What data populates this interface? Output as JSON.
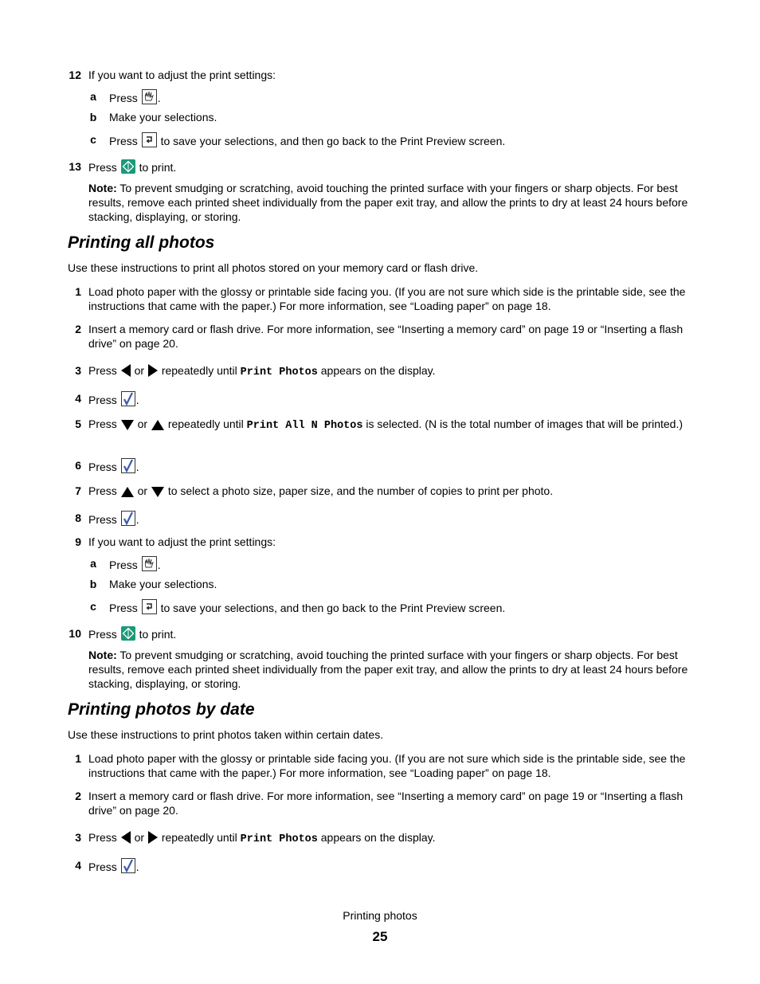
{
  "section1": {
    "step12": {
      "num": "12",
      "text": "If you want to adjust the print settings:"
    },
    "step12a": {
      "letter": "a",
      "pre": "Press",
      "post": "."
    },
    "step12b": {
      "letter": "b",
      "text": "Make your selections."
    },
    "step12c": {
      "letter": "c",
      "pre": "Press",
      "post": "to save your selections, and then go back to the Print Preview screen."
    },
    "step13": {
      "num": "13",
      "pre": "Press",
      "post": "to print."
    },
    "note": {
      "label": "Note:",
      "text": "To prevent smudging or scratching, avoid touching the printed surface with your fingers or sharp objects. For best results, remove each printed sheet individually from the paper exit tray, and allow the prints to dry at least 24 hours before stacking, displaying, or storing."
    }
  },
  "section2": {
    "heading": "Printing all photos",
    "intro": "Use these instructions to print all photos stored on your memory card or flash drive.",
    "steps": [
      {
        "num": "1",
        "text": "Load photo paper with the glossy or printable side facing you. (If you are not sure which side is the printable side, see the instructions that came with the paper.) For more information, see “Loading paper” on page 18."
      },
      {
        "num": "2",
        "text": "Insert a memory card or flash drive. For more information, see “Inserting a memory card” on page 19 or “Inserting a flash drive” on page 20."
      },
      {
        "num": "3",
        "pre": "Press",
        "or": "or",
        "mid": "repeatedly until",
        "code": "Print Photos",
        "post": "appears on the display."
      },
      {
        "num": "4",
        "pre": "Press",
        "post": "."
      },
      {
        "num": "5",
        "pre": "Press",
        "or": "or",
        "mid": "repeatedly until",
        "code": "Print All N Photos",
        "post": "is selected. (N is the total number of images that will be printed.)"
      },
      {
        "num": "6",
        "pre": "Press",
        "post": "."
      },
      {
        "num": "7",
        "pre": "Press",
        "or": "or",
        "post": "to select a photo size, paper size, and the number of copies to print per photo."
      },
      {
        "num": "8",
        "pre": "Press",
        "post": "."
      },
      {
        "num": "9",
        "text": "If you want to adjust the print settings:"
      },
      {
        "num": "10",
        "pre": "Press",
        "post": "to print."
      }
    ],
    "step9a": {
      "letter": "a",
      "pre": "Press",
      "post": "."
    },
    "step9b": {
      "letter": "b",
      "text": "Make your selections."
    },
    "step9c": {
      "letter": "c",
      "pre": "Press",
      "post": "to save your selections, and then go back to the Print Preview screen."
    },
    "note": {
      "label": "Note:",
      "text": "To prevent smudging or scratching, avoid touching the printed surface with your fingers or sharp objects. For best results, remove each printed sheet individually from the paper exit tray, and allow the prints to dry at least 24 hours before stacking, displaying, or storing."
    }
  },
  "section3": {
    "heading": "Printing photos by date",
    "intro": "Use these instructions to print photos taken within certain dates.",
    "steps": [
      {
        "num": "1",
        "text": "Load photo paper with the glossy or printable side facing you. (If you are not sure which side is the printable side, see the instructions that came with the paper.) For more information, see “Loading paper” on page 18."
      },
      {
        "num": "2",
        "text": "Insert a memory card or flash drive. For more information, see “Inserting a memory card” on page 19 or “Inserting a flash drive” on page 20."
      },
      {
        "num": "3",
        "pre": "Press",
        "or": "or",
        "mid": "repeatedly until",
        "code": "Print Photos",
        "post": "appears on the display."
      },
      {
        "num": "4",
        "pre": "Press",
        "post": "."
      }
    ]
  },
  "icons": {
    "settings": "settings-hand-icon",
    "back": "back-arrow-icon",
    "start": "start-diamond-icon",
    "select": "checkmark-select-icon",
    "left": "left-arrow-icon",
    "right": "right-arrow-icon",
    "up": "up-arrow-icon",
    "down": "down-arrow-icon"
  },
  "colors": {
    "start_button": "#1a9a7a",
    "checkmark": "#3a5ca8"
  },
  "footer": {
    "title": "Printing photos",
    "page": "25"
  }
}
